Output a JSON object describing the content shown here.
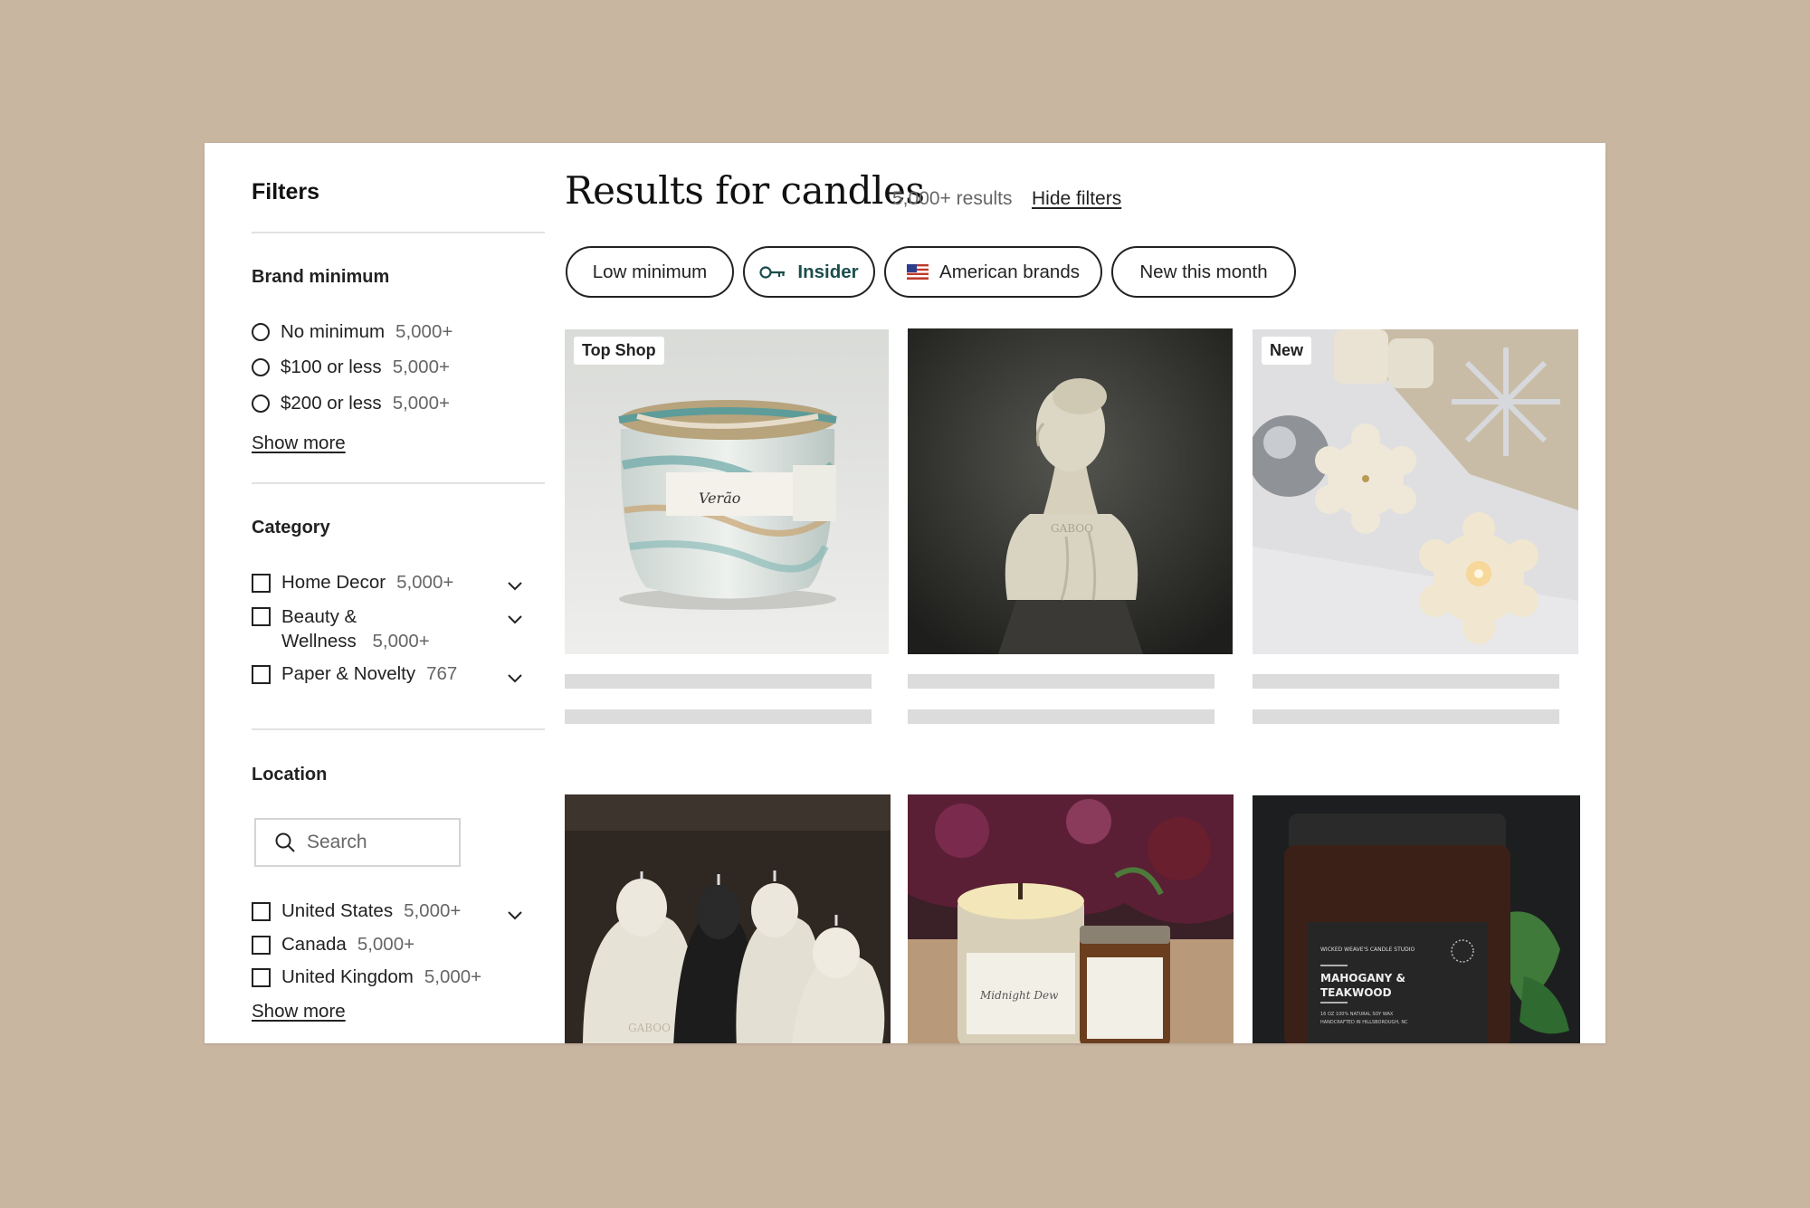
{
  "sidebar": {
    "title": "Filters",
    "brand_minimum": {
      "title": "Brand minimum",
      "options": [
        {
          "label": "No minimum",
          "count": "5,000+"
        },
        {
          "label": "$100 or less",
          "count": "5,000+"
        },
        {
          "label": "$200 or less",
          "count": "5,000+"
        }
      ],
      "show_more": "Show more"
    },
    "category": {
      "title": "Category",
      "options": [
        {
          "label": "Home Decor",
          "count": "5,000+"
        },
        {
          "label_line1": "Beauty &",
          "label_line2": "Wellness",
          "count": "5,000+"
        },
        {
          "label": "Paper & Novelty",
          "count": "767"
        }
      ]
    },
    "location": {
      "title": "Location",
      "search_placeholder": "Search",
      "options": [
        {
          "label": "United States",
          "count": "5,000+"
        },
        {
          "label": "Canada",
          "count": "5,000+"
        },
        {
          "label": "United Kingdom",
          "count": "5,000+"
        }
      ],
      "show_more": "Show more"
    }
  },
  "main": {
    "title": "Results for candles",
    "results_count": "5,000+ results",
    "hide_filters": "Hide filters",
    "chips": [
      {
        "label": "Low minimum"
      },
      {
        "label": "Insider",
        "icon": "key-icon"
      },
      {
        "label": "American brands",
        "icon": "us-flag-icon"
      },
      {
        "label": "New this month"
      }
    ],
    "products": [
      {
        "badge": "Top Shop",
        "image": "marbled candle jar",
        "jar_label": "Verão"
      },
      {
        "badge": "",
        "image": "bust sculpture candle",
        "mark": "GABOO"
      },
      {
        "badge": "New",
        "image": "snowflake wax melts"
      },
      {
        "badge": "",
        "image": "veiled bust candles",
        "mark": "GABOO"
      },
      {
        "badge": "",
        "image": "midnight dew candle jars",
        "jar_label": "Midnight Dew"
      },
      {
        "badge": "",
        "image": "amber candle jar",
        "label_brand": "WICKED WEAVE'S CANDLE STUDIO",
        "label_title_1": "MAHOGANY &",
        "label_title_2": "TEAKWOOD",
        "label_sub": "16 OZ 100% NATURAL SOY WAX",
        "label_sub2": "HANDCRAFTED IN HILLSBOROUGH, NC"
      }
    ]
  },
  "colors": {
    "background": "#c9b6a1",
    "insider_accent": "#1b4d4d",
    "skeleton": "#dcdcdc"
  }
}
